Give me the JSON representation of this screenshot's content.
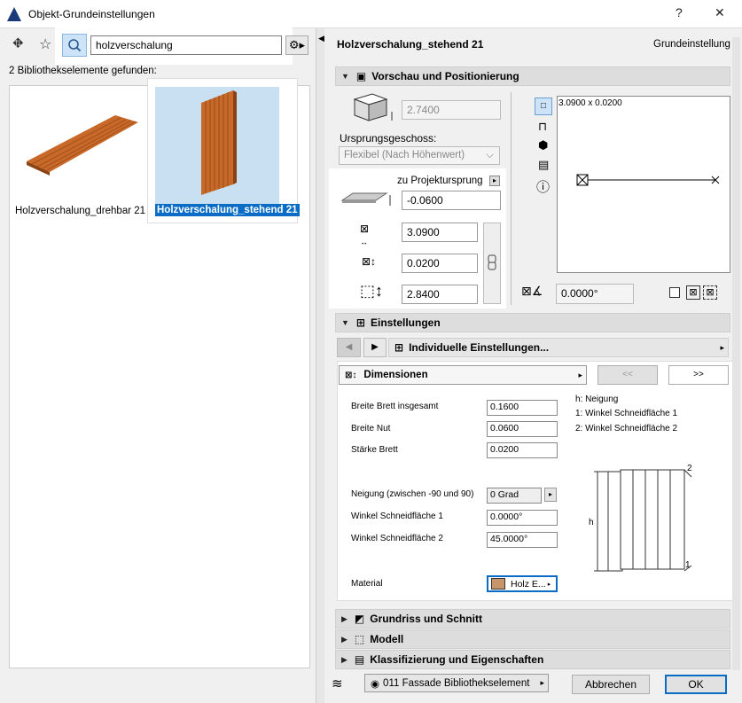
{
  "window": {
    "title": "Objekt-Grundeinstellungen",
    "help": "?",
    "close": "✕"
  },
  "library": {
    "search_value": "holzverschalung",
    "found_text": "2 Bibliothekselemente gefunden:",
    "items": [
      {
        "label": "Holzverschalung_drehbar 21"
      },
      {
        "label": "Holzverschalung_stehend 21"
      }
    ]
  },
  "header": {
    "object_name": "Holzverschalung_stehend 21",
    "mode": "Grundeinstellung"
  },
  "preview_section": {
    "title": "Vorschau und Positionierung",
    "height_value": "2.7400",
    "story_label": "Ursprungsgeschoss:",
    "story_value": "Flexibel (Nach Höhenwert)",
    "origin_label": "zu Projektursprung",
    "elevation": "-0.0600",
    "width": "3.0900",
    "depth": "0.0200",
    "height": "2.8400",
    "preview_dims": "3.0900 x 0.0200",
    "angle": "0.0000°"
  },
  "settings_section": {
    "title": "Einstellungen",
    "subpanel": "Individuelle Einstellungen...",
    "page": "Dimensionen",
    "prev": "<<",
    "next": ">>",
    "params": {
      "breite_brett_label": "Breite Brett insgesamt",
      "breite_brett": "0.1600",
      "breite_nut_label": "Breite Nut",
      "breite_nut": "0.0600",
      "staerke_label": "Stärke Brett",
      "staerke": "0.0200",
      "neigung_label": "Neigung (zwischen -90 und 90)",
      "neigung": "0 Grad",
      "winkel1_label": "Winkel Schneidfläche 1",
      "winkel1": "0.0000°",
      "winkel2_label": "Winkel Schneidfläche 2",
      "winkel2": "45.0000°",
      "material_label": "Material",
      "material": "Holz E..."
    },
    "legend": [
      "h: Neigung",
      "1: Winkel Schneidfläche 1",
      "2: Winkel Schneidfläche 2"
    ],
    "diagram_labels": {
      "h": "h",
      "one": "1",
      "two": "2"
    }
  },
  "other_sections": [
    "Grundriss und Schnitt",
    "Modell",
    "Klassifizierung und Eigenschaften"
  ],
  "footer": {
    "layer": "011 Fassade Bibliothekselement",
    "cancel": "Abbrechen",
    "ok": "OK"
  },
  "colors": {
    "accent": "#0a6cc4",
    "wood": "#c8692a",
    "material_swatch": "#c8956a"
  }
}
